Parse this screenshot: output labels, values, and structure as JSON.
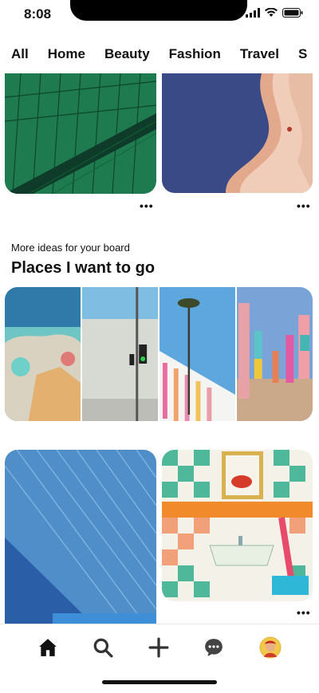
{
  "status": {
    "time": "8:08"
  },
  "tabs": [
    {
      "label": "All",
      "active": true
    },
    {
      "label": "Home"
    },
    {
      "label": "Beauty"
    },
    {
      "label": "Fashion"
    },
    {
      "label": "Travel"
    },
    {
      "label": "S"
    }
  ],
  "section": {
    "subtitle": "More ideas for your board",
    "title": "Places I want to go"
  },
  "more_label": "•••",
  "nav": {
    "items": [
      "home-icon",
      "search-icon",
      "add-icon",
      "messages-icon",
      "profile-avatar"
    ]
  },
  "colors": {
    "accent": "#111111",
    "green_court": "#1e7a4f",
    "water": "#3a4a86",
    "sand": "#e3a98c"
  }
}
